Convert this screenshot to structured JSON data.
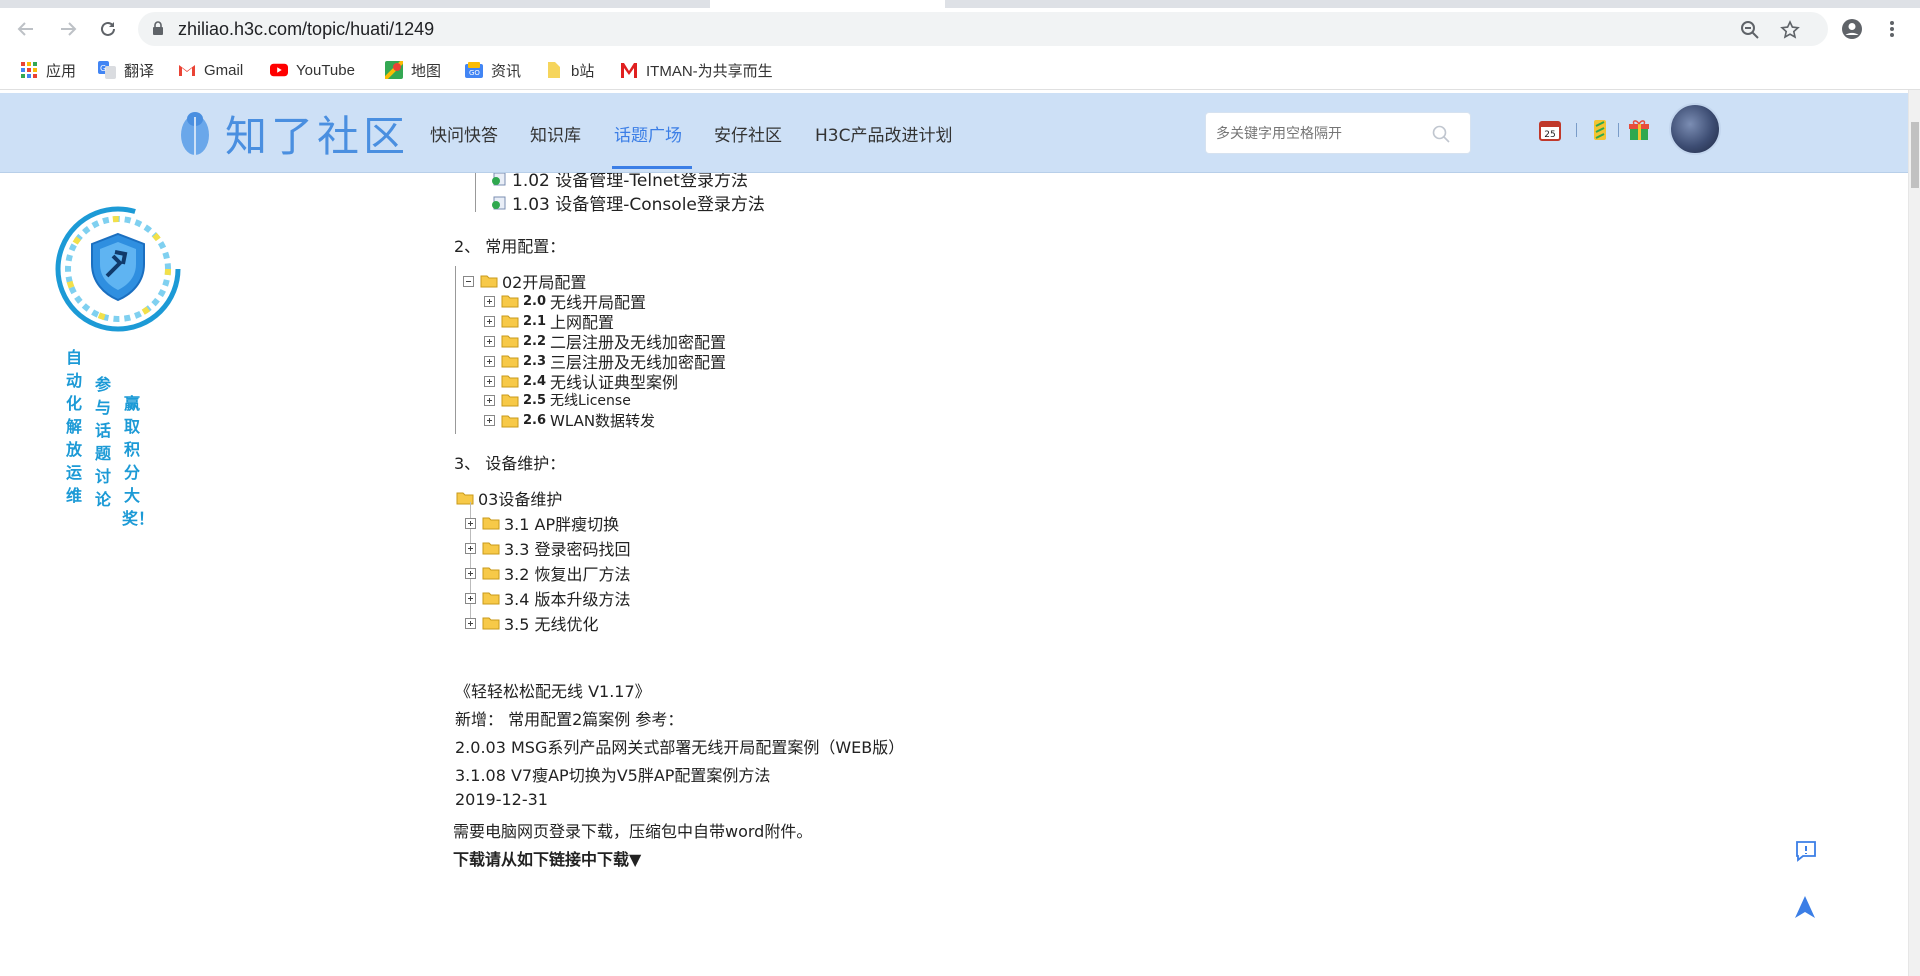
{
  "browser": {
    "url": "zhiliao.h3c.com/topic/huati/1249",
    "bookmarks": [
      {
        "label": "应用",
        "icon": "apps-grid-icon"
      },
      {
        "label": "翻译",
        "icon": "translate-icon"
      },
      {
        "label": "Gmail",
        "icon": "gmail-icon"
      },
      {
        "label": "YouTube",
        "icon": "youtube-icon"
      },
      {
        "label": "地图",
        "icon": "maps-icon"
      },
      {
        "label": "资讯",
        "icon": "news-icon"
      },
      {
        "label": "b站",
        "icon": "folder-icon"
      },
      {
        "label": "ITMAN-为共享而生",
        "icon": "itman-logo-icon"
      }
    ]
  },
  "header": {
    "logo_text": "知了社区",
    "nav": [
      "快问快答",
      "知识库",
      "话题广场",
      "安仔社区",
      "H3C产品改进计划"
    ],
    "active_nav": "话题广场",
    "search_placeholder": "多关键字用空格隔开",
    "calendar_day": "25"
  },
  "promo": {
    "col1": "自动化解放运维",
    "col2": "参与话题讨论",
    "col3": "赢取积分大奖！"
  },
  "content": {
    "top_items": [
      "1.02 设备管理-Telnet登录方法",
      "1.03 设备管理-Console登录方法"
    ],
    "section2_heading": "2、  常用配置：",
    "section2_root": "02开局配置",
    "section2_items": [
      {
        "num": "2.0",
        "label": "无线开局配置"
      },
      {
        "num": "2.1",
        "label": "上网配置"
      },
      {
        "num": "2.2",
        "label": "二层注册及无线加密配置"
      },
      {
        "num": "2.3",
        "label": "三层注册及无线加密配置"
      },
      {
        "num": "2.4",
        "label": "无线认证典型案例"
      },
      {
        "num": "2.5",
        "label": "无线License"
      },
      {
        "num": "2.6",
        "label": "WLAN数据转发"
      }
    ],
    "section3_heading": "3、  设备维护：",
    "section3_root": "03设备维护",
    "section3_items": [
      "3.1 AP胖瘦切换",
      "3.3 登录密码找回",
      "3.2 恢复出厂方法",
      "3.4 版本升级方法",
      "3.5 无线优化"
    ],
    "paragraphs": [
      "《轻轻松松配无线 V1.17》",
      " 新增：  常用配置2篇案例 参考：",
      " 2.0.03 MSG系列产品网关式部署无线开局配置案例（WEB版）",
      " 3.1.08 V7瘦AP切换为V5胖AP配置案例方法",
      " 2019-12-31",
      "需要电脑网页登录下载，压缩包中自带word附件。",
      "下载请从如下链接中下载▼"
    ]
  },
  "colors": {
    "header_bg": "#cde0f6",
    "accent": "#3b7ee6",
    "promo_text": "#1c9ad6"
  }
}
